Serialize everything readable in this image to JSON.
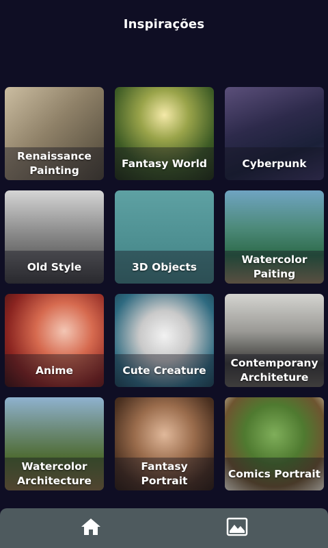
{
  "header": {
    "title": "Inspirações"
  },
  "cards": [
    {
      "label": "Renaissance Painting",
      "bg": "linear-gradient(135deg,#cbbda1 0%,#8f8168 45%,#4b4436 100%)"
    },
    {
      "label": "Fantasy World",
      "bg": "radial-gradient(circle at 50% 30%,#f4e9a8 0%,#9aa44a 30%,#3d5b25 65%,#1f2d14 100%)"
    },
    {
      "label": "Cyberpunk",
      "bg": "linear-gradient(160deg,#5b4f7a 0%,#2d2a4b 40%,#1a2038 70%,#3b3560 100%)"
    },
    {
      "label": "Old Style",
      "bg": "linear-gradient(180deg,#d5d5d5 0%,#8c8c8c 45%,#3a3a3a 100%)"
    },
    {
      "label": "3D Objects",
      "bg": "linear-gradient(180deg,#5ea1a3 0%,#4c8e90 60%,#3f7b7c 100%)"
    },
    {
      "label": "Watercolor Paiting",
      "bg": "linear-gradient(180deg,#6fa4c2 0%,#4d8a7a 40%,#2d6a4a 70%,#8c7a5a 100%)"
    },
    {
      "label": "Anime",
      "bg": "radial-gradient(circle at 60% 40%,#f3c6b4 0%,#d66a4f 35%,#8a2420 70%,#3a1010 100%)"
    },
    {
      "label": "Cute Creature",
      "bg": "radial-gradient(circle at 50% 45%,#f2f2f2 0%,#c9c9c9 35%,#2e6a80 75%,#1c4454 100%)"
    },
    {
      "label": "Contemporany Architeture",
      "bg": "linear-gradient(180deg,#d4d4d0 0%,#9b9a96 40%,#3a3a38 75%,#5e5b52 100%)"
    },
    {
      "label": "Watercolor Architecture",
      "bg": "linear-gradient(180deg,#8fb2cf 0%,#6c8a78 35%,#4e6b32 65%,#7e6a3e 100%)"
    },
    {
      "label": "Fantasy Portrait",
      "bg": "radial-gradient(circle at 50% 40%,#e0b89a 0%,#9a6c4c 40%,#4a3020 75%,#2b1c12 100%)"
    },
    {
      "label": "Comics Portrait",
      "bg": "radial-gradient(circle at 50% 40%,#7fae5a 0%,#4f7a30 40%,#6e5530 70%,#e7e2d0 100%)"
    }
  ],
  "bottom_nav": [
    {
      "name": "home",
      "icon": "home-icon"
    },
    {
      "name": "gallery",
      "icon": "image-icon"
    }
  ],
  "colors": {
    "background": "#0f0e24",
    "bottom_bar": "#4e5a5e"
  }
}
